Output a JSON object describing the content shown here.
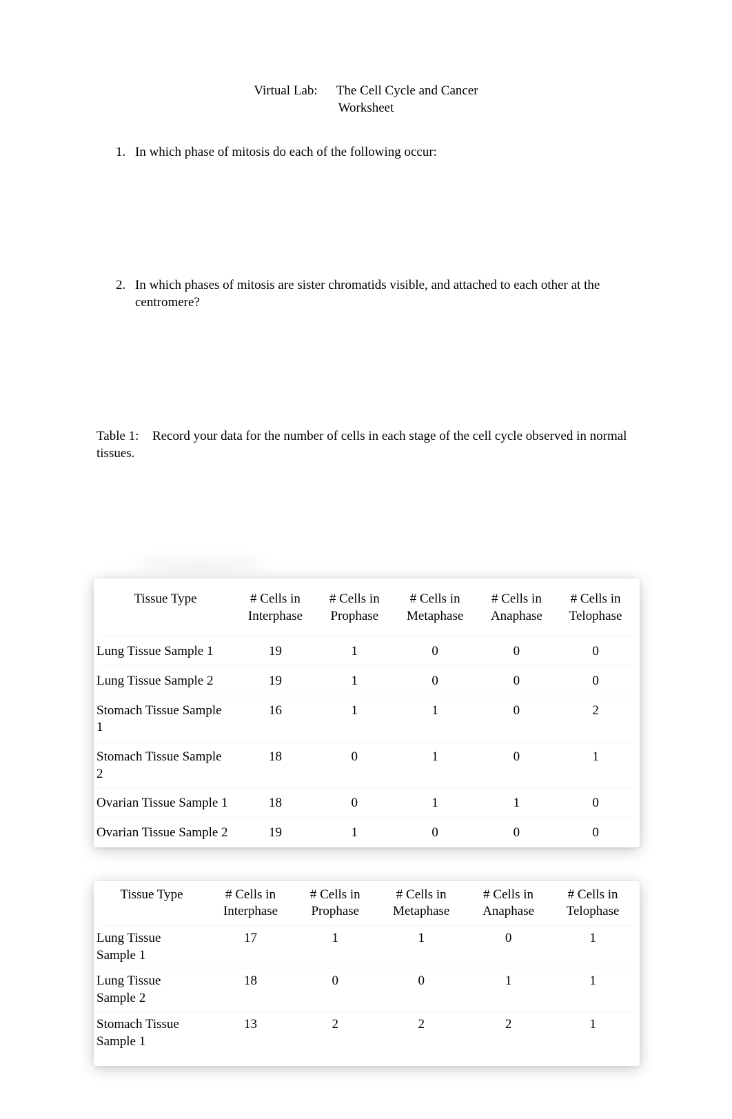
{
  "title": {
    "prefix": "Virtual Lab:",
    "main": "The Cell Cycle and Cancer",
    "sub": "Worksheet"
  },
  "questions": [
    {
      "num": "1.",
      "text": "In which phase of mitosis do each of the following occur:"
    },
    {
      "num": "2.",
      "text": "In which phases of mitosis are sister chromatids visible, and attached to each other at the centromere?"
    }
  ],
  "table1_caption": {
    "label": "Table 1:",
    "text": "Record your data for the number of cells in each stage of the cell cycle observed in normal tissues."
  },
  "columns": {
    "tissue": "Tissue Type",
    "interphase_l1": "# Cells in",
    "interphase_l2": "Interphase",
    "prophase_l1": "# Cells in",
    "prophase_l2": "Prophase",
    "metaphase_l1": "# Cells in",
    "metaphase_l2": "Metaphase",
    "anaphase_l1": "# Cells in",
    "anaphase_l2": "Anaphase",
    "telophase_l1": "# Cells in",
    "telophase_l2": "Telophase"
  },
  "chart_data": [
    {
      "type": "table",
      "title": "Table 1 — normal tissues",
      "columns": [
        "Tissue Type",
        "# Cells in Interphase",
        "# Cells in Prophase",
        "# Cells in Metaphase",
        "# Cells in Anaphase",
        "# Cells in Telophase"
      ],
      "rows": [
        {
          "tissue": "Lung Tissue Sample 1",
          "interphase": "19",
          "prophase": "1",
          "metaphase": "0",
          "anaphase": "0",
          "telophase": "0"
        },
        {
          "tissue": "Lung Tissue Sample 2",
          "interphase": "19",
          "prophase": "1",
          "metaphase": "0",
          "anaphase": "0",
          "telophase": "0"
        },
        {
          "tissue": "Stomach Tissue Sample 1",
          "interphase": "16",
          "prophase": "1",
          "metaphase": "1",
          "anaphase": "0",
          "telophase": "2"
        },
        {
          "tissue": "Stomach Tissue Sample 2",
          "interphase": "18",
          "prophase": "0",
          "metaphase": "1",
          "anaphase": "0",
          "telophase": "1"
        },
        {
          "tissue": "Ovarian Tissue Sample 1",
          "interphase": "18",
          "prophase": "0",
          "metaphase": "1",
          "anaphase": "1",
          "telophase": "0"
        },
        {
          "tissue": "Ovarian Tissue Sample 2",
          "interphase": "19",
          "prophase": "1",
          "metaphase": "0",
          "anaphase": "0",
          "telophase": "0"
        }
      ]
    },
    {
      "type": "table",
      "title": "Table 2",
      "columns": [
        "Tissue Type",
        "# Cells in Interphase",
        "# Cells in Prophase",
        "# Cells in Metaphase",
        "# Cells in Anaphase",
        "# Cells in Telophase"
      ],
      "rows": [
        {
          "tissue_l1": "Lung Tissue",
          "tissue_l2": "Sample 1",
          "interphase": "17",
          "prophase": "1",
          "metaphase": "1",
          "anaphase": "0",
          "telophase": "1"
        },
        {
          "tissue_l1": "Lung Tissue",
          "tissue_l2": "Sample 2",
          "interphase": "18",
          "prophase": "0",
          "metaphase": "0",
          "anaphase": "1",
          "telophase": "1"
        },
        {
          "tissue_l1": "Stomach Tissue",
          "tissue_l2": "Sample 1",
          "interphase": "13",
          "prophase": "2",
          "metaphase": "2",
          "anaphase": "2",
          "telophase": "1"
        }
      ]
    }
  ]
}
